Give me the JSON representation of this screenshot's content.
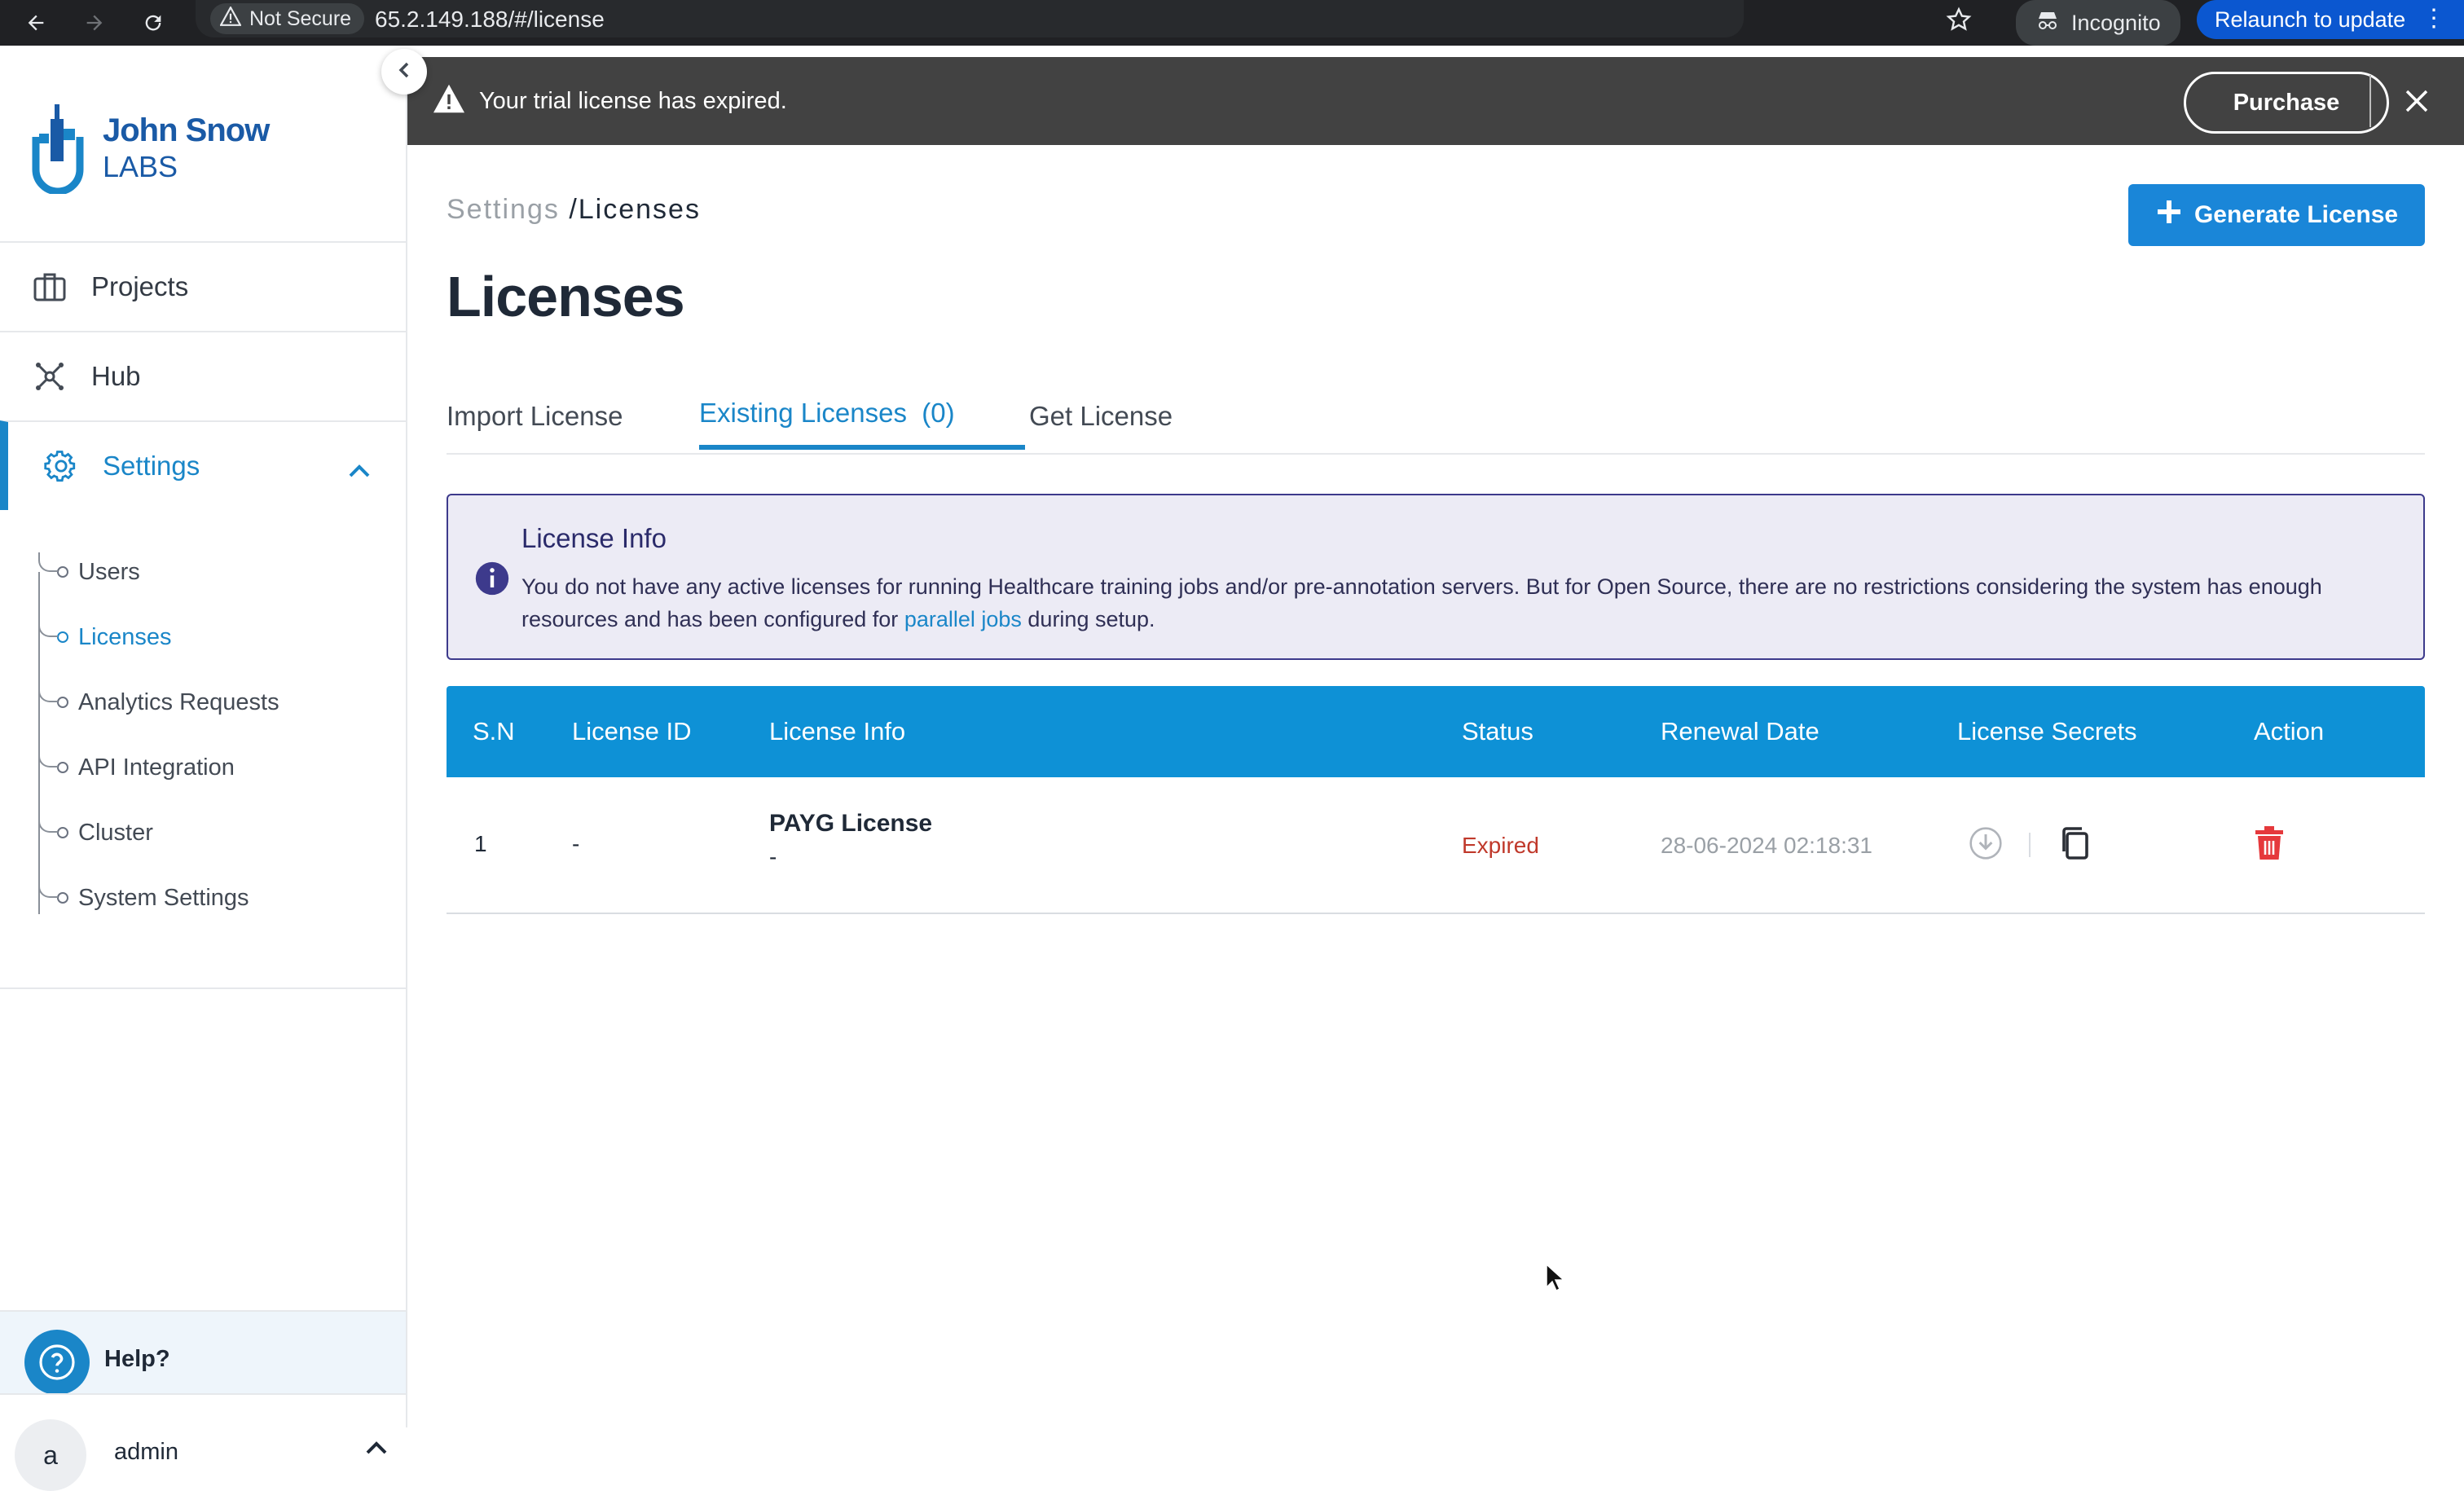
{
  "browser": {
    "security_label": "Not Secure",
    "url": "65.2.149.188/#/license",
    "incognito_label": "Incognito",
    "relaunch_label": "Relaunch to update"
  },
  "brand": {
    "line1": "John Snow",
    "line2": "LABS"
  },
  "sidebar": {
    "items": [
      {
        "label": "Projects",
        "icon": "briefcase-icon"
      },
      {
        "label": "Hub",
        "icon": "hub-network-icon"
      },
      {
        "label": "Settings",
        "icon": "gear-icon"
      }
    ],
    "subitems": [
      {
        "label": "Users"
      },
      {
        "label": "Licenses"
      },
      {
        "label": "Analytics Requests"
      },
      {
        "label": "API Integration"
      },
      {
        "label": "Cluster"
      },
      {
        "label": "System Settings"
      }
    ],
    "help_label": "Help?",
    "user": {
      "avatar_letter": "a",
      "name": "admin"
    }
  },
  "banner": {
    "message": "Your trial license has expired.",
    "purchase_label": "Purchase"
  },
  "breadcrumb": {
    "parent": "Settings",
    "sep": "/",
    "current": "Licenses"
  },
  "header": {
    "generate_label": "Generate License",
    "title": "Licenses"
  },
  "tabs": [
    {
      "label": "Import License"
    },
    {
      "label": "Existing Licenses  (0)"
    },
    {
      "label": "Get License"
    }
  ],
  "info": {
    "title": "License Info",
    "text_before": "You do not have any active licenses for running Healthcare training jobs and/or pre-annotation servers. But for Open Source, there are no restrictions considering the system has enough resources and has been configured for ",
    "link": "parallel jobs",
    "text_after": " during setup."
  },
  "table": {
    "headers": [
      "S.N",
      "License ID",
      "License Info",
      "Status",
      "Renewal Date",
      "License Secrets",
      "Action"
    ],
    "rows": [
      {
        "sn": "1",
        "license_id": "-",
        "info_title": "PAYG License",
        "info_sub": "-",
        "status": "Expired",
        "renewal_date": "28-06-2024 02:18:31"
      }
    ]
  },
  "colors": {
    "accent": "#1a86c8",
    "table_header": "#0e91d6",
    "banner_bg": "#424242",
    "status_expired": "#c0392b",
    "info_border": "#3d3a8c",
    "info_bg": "#ecebf5"
  }
}
